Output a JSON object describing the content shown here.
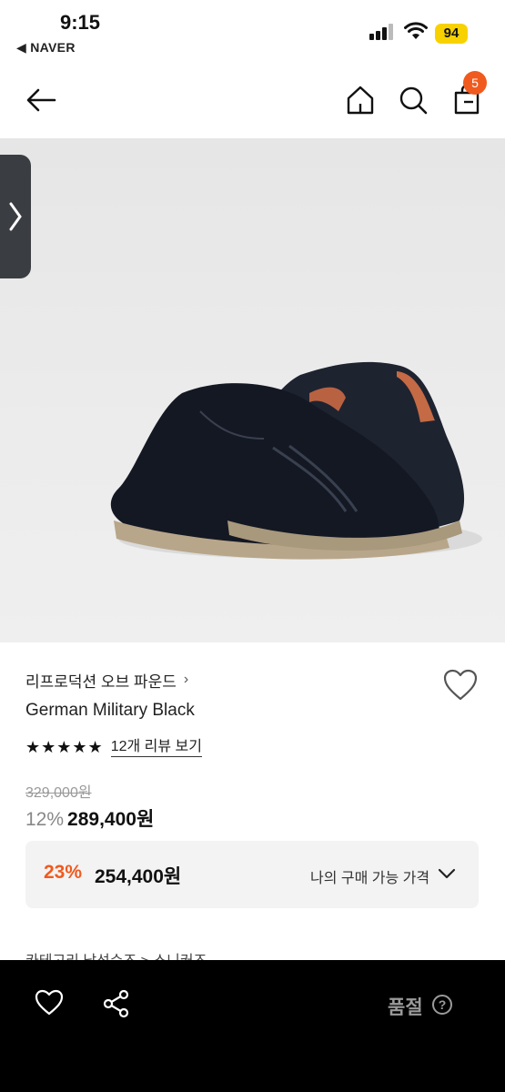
{
  "status_bar": {
    "time": "9:15",
    "back_app": "◀ NAVER",
    "battery": "94",
    "signal_icon": "cellular-signal-icon",
    "wifi_icon": "wifi-icon"
  },
  "nav": {
    "back_icon": "arrow-left-icon",
    "home_icon": "home-icon",
    "search_icon": "search-icon",
    "cart_icon": "cart-icon",
    "cart_count": "5"
  },
  "product": {
    "image_alt": "black leather sneakers with gum sole",
    "brand": "리프로덕션 오브 파운드",
    "brand_chevron": "›",
    "name": "German Military Black",
    "stars": "★★★★★",
    "review_link": "12개 리뷰 보기",
    "original_price": "329,000원",
    "discount_rate": "12%",
    "sale_price": "289,400원"
  },
  "member_price": {
    "rate": "23%",
    "price": "254,400원",
    "label": "나의 구매 가능 가격"
  },
  "category": {
    "text": "카테고리     남성슈즈 > 스니커즈"
  },
  "bottom_bar": {
    "heart_icon": "heart-icon",
    "share_icon": "share-icon",
    "status": "품절",
    "help": "?"
  },
  "colors": {
    "accent": "#f05a1e",
    "bottom_bar": "#000000",
    "member_box": "#f3f3f4"
  }
}
